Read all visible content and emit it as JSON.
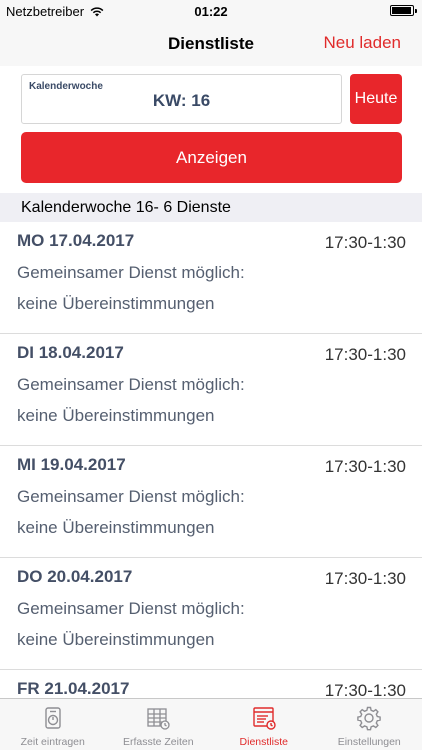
{
  "status_bar": {
    "carrier": "Netzbetreiber",
    "time": "01:22",
    "battery_level": 0.95
  },
  "nav": {
    "title": "Dienstliste",
    "reload_label": "Neu laden"
  },
  "week_selector": {
    "label": "Kalenderwoche",
    "value": "KW: 16",
    "today_label": "Heute"
  },
  "show_button": "Anzeigen",
  "section_header": "Kalenderwoche 16- 6 Dienste",
  "shifts": [
    {
      "date": "MO 17.04.2017",
      "time": "17:30-1:30",
      "shared": "Gemeinsamer Dienst möglich:",
      "matches": "keine Übereinstimmungen"
    },
    {
      "date": "DI 18.04.2017",
      "time": "17:30-1:30",
      "shared": "Gemeinsamer Dienst möglich:",
      "matches": "keine Übereinstimmungen"
    },
    {
      "date": "MI 19.04.2017",
      "time": "17:30-1:30",
      "shared": "Gemeinsamer Dienst möglich:",
      "matches": "keine Übereinstimmungen"
    },
    {
      "date": "DO 20.04.2017",
      "time": "17:30-1:30",
      "shared": "Gemeinsamer Dienst möglich:",
      "matches": "keine Übereinstimmungen"
    },
    {
      "date": "FR 21.04.2017",
      "time": "17:30-1:30",
      "shared": "",
      "matches": ""
    }
  ],
  "tabs": [
    {
      "label": "Zeit eintragen",
      "icon": "stopwatch-icon",
      "active": false
    },
    {
      "label": "Erfasste Zeiten",
      "icon": "table-clock-icon",
      "active": false
    },
    {
      "label": "Dienstliste",
      "icon": "list-clock-icon",
      "active": true
    },
    {
      "label": "Einstellungen",
      "icon": "gear-icon",
      "active": false
    }
  ],
  "colors": {
    "accent": "#e8262b",
    "inactive_tab": "#8e8e93"
  }
}
